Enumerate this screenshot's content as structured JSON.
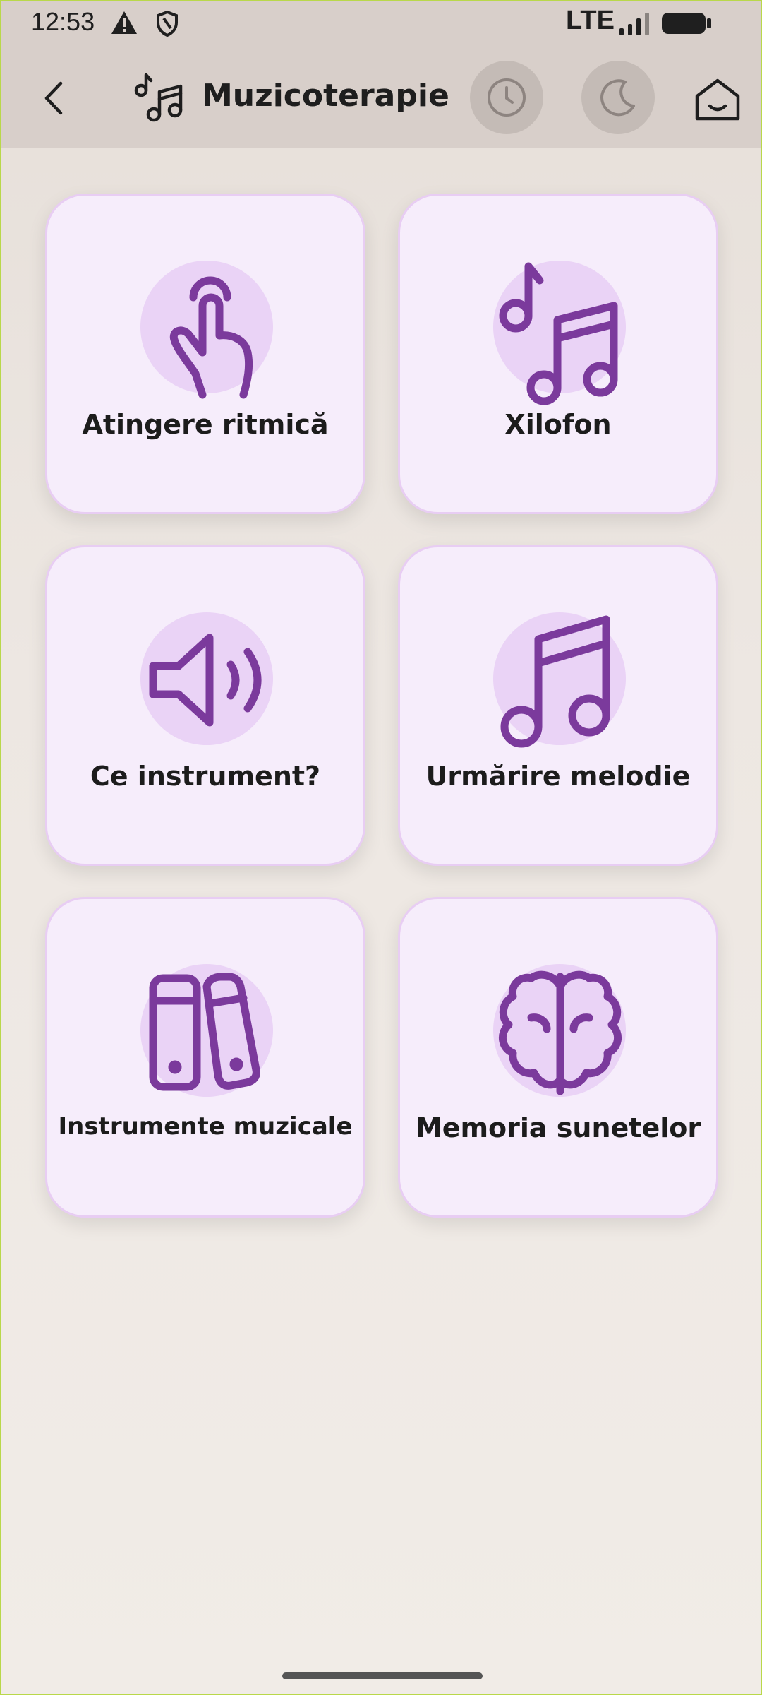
{
  "status_bar": {
    "time": "12:53",
    "network": "LTE",
    "icons": [
      "alert-icon",
      "shield-icon",
      "signal-icon",
      "battery-icon"
    ]
  },
  "app_bar": {
    "title": "Muzicoterapie",
    "icons": [
      "back-arrow-icon",
      "music-notes-icon",
      "clock-icon",
      "moon-icon",
      "home-icon"
    ]
  },
  "cards": [
    {
      "label": "Atingere ritmică",
      "icon": "tap-hand-icon"
    },
    {
      "label": "Xilofon",
      "icon": "music-notes-icon"
    },
    {
      "label": "Ce instrument?",
      "icon": "speaker-icon"
    },
    {
      "label": "Urmărire melodie",
      "icon": "music-note-icon"
    },
    {
      "label": "Instrumente muzicale",
      "icon": "instruments-icon"
    },
    {
      "label": "Memoria sunetelor",
      "icon": "brain-icon"
    }
  ],
  "colors": {
    "accent": "#7b3a9c",
    "card_bg": "#f6edfb",
    "card_border": "#e8cdf3",
    "icon_circle": "#ead3f6",
    "appbar_bg": "#d8cfca"
  }
}
